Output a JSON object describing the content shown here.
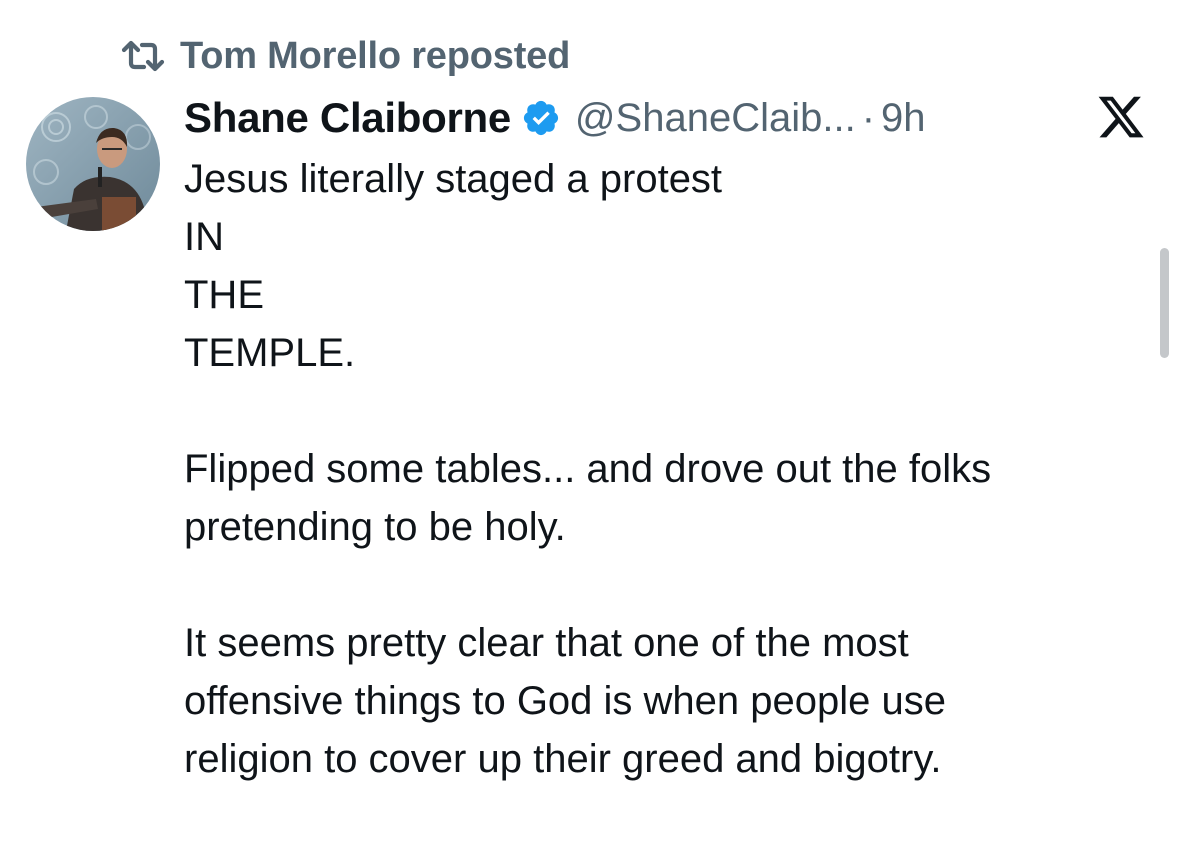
{
  "repost": {
    "icon": "repost-icon",
    "text": "Tom Morello reposted"
  },
  "author": {
    "avatar_icon": "avatar",
    "name": "Shane Claiborne",
    "verified_icon": "verified-badge-icon",
    "handle": "@ShaneClaib...",
    "separator": "·",
    "time": "9h"
  },
  "platform_logo": "x-logo-icon",
  "tweet": {
    "lines": [
      "Jesus literally staged a protest",
      "IN",
      "THE",
      "TEMPLE.",
      "",
      "Flipped some tables... and drove out the folks",
      "pretending to be holy.",
      "",
      "It seems pretty clear that one of the most",
      "offensive things to God is when people use",
      "religion to cover up their greed and bigotry."
    ]
  },
  "colors": {
    "text_primary": "#0f1419",
    "text_secondary": "#536471",
    "verified_blue": "#1d9bf0",
    "link_blue": "#1d9bf0"
  }
}
